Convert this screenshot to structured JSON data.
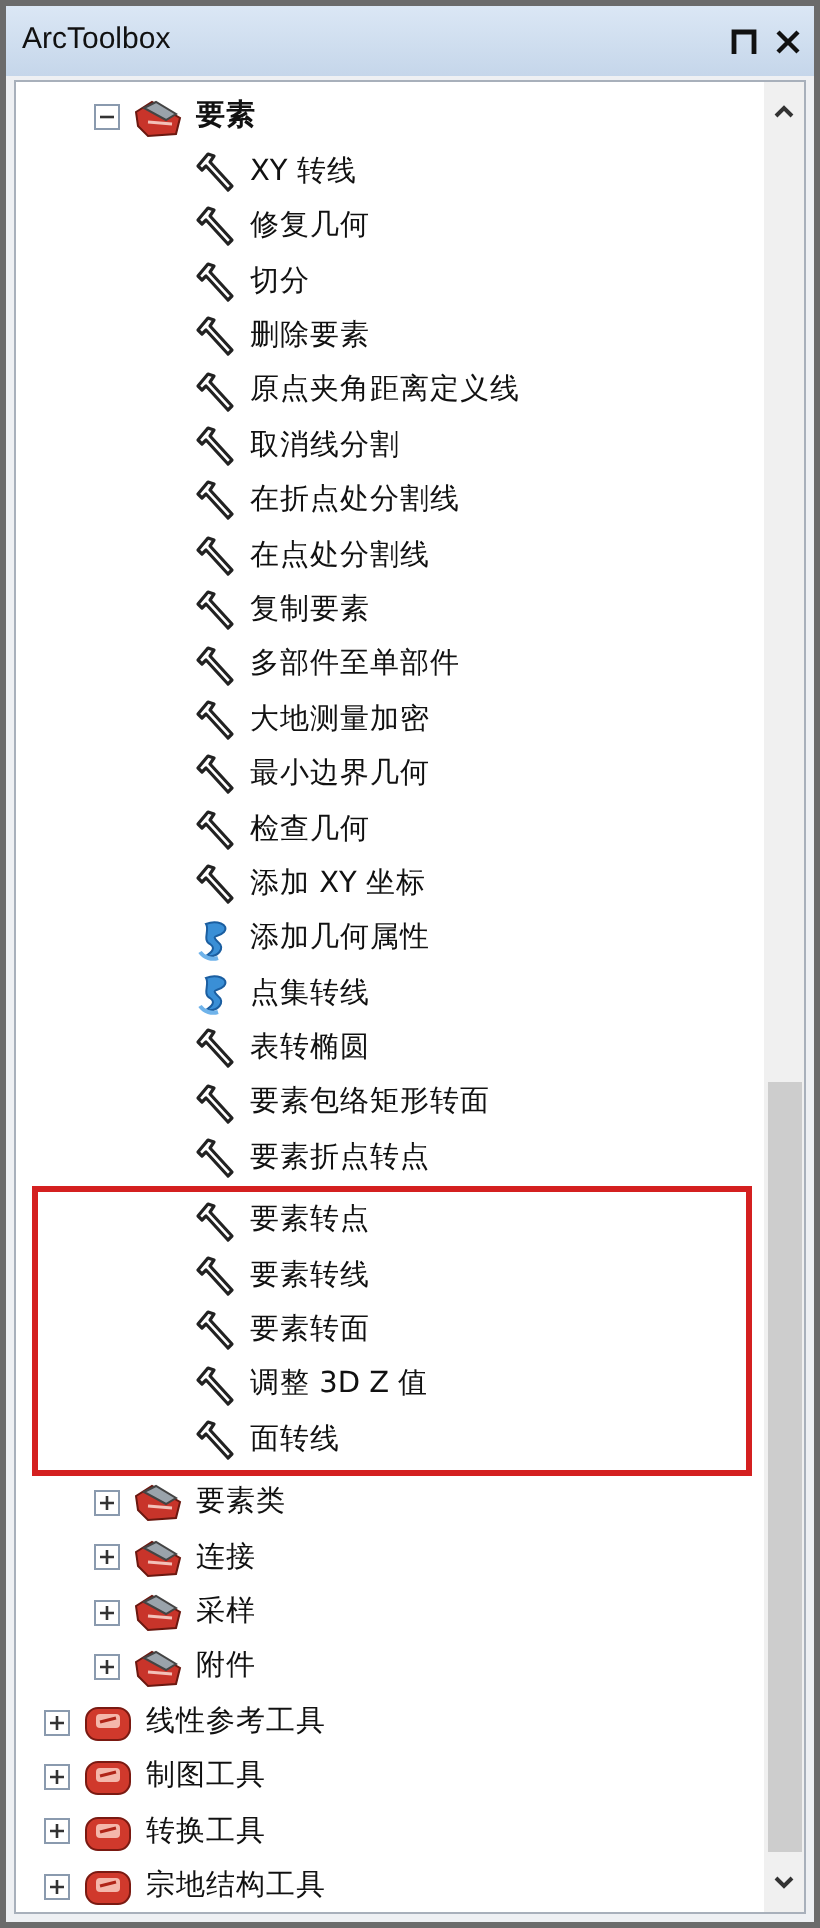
{
  "window": {
    "title": "ArcToolbox"
  },
  "toolsets": [
    {
      "label": "要素",
      "expanded": true,
      "children": [
        {
          "label": "XY 转线",
          "kind": "tool",
          "boxed": false
        },
        {
          "label": "修复几何",
          "kind": "tool",
          "boxed": false
        },
        {
          "label": "切分",
          "kind": "tool",
          "boxed": false
        },
        {
          "label": "删除要素",
          "kind": "tool",
          "boxed": false
        },
        {
          "label": "原点夹角距离定义线",
          "kind": "tool",
          "boxed": false
        },
        {
          "label": "取消线分割",
          "kind": "tool",
          "boxed": false
        },
        {
          "label": "在折点处分割线",
          "kind": "tool",
          "boxed": false
        },
        {
          "label": "在点处分割线",
          "kind": "tool",
          "boxed": false
        },
        {
          "label": "复制要素",
          "kind": "tool",
          "boxed": false
        },
        {
          "label": "多部件至单部件",
          "kind": "tool",
          "boxed": false
        },
        {
          "label": "大地测量加密",
          "kind": "tool",
          "boxed": false
        },
        {
          "label": "最小边界几何",
          "kind": "tool",
          "boxed": false
        },
        {
          "label": "检查几何",
          "kind": "tool",
          "boxed": false
        },
        {
          "label": "添加 XY 坐标",
          "kind": "tool",
          "boxed": false
        },
        {
          "label": "添加几何属性",
          "kind": "script",
          "boxed": false
        },
        {
          "label": "点集转线",
          "kind": "script",
          "boxed": false
        },
        {
          "label": "表转椭圆",
          "kind": "tool",
          "boxed": false
        },
        {
          "label": "要素包络矩形转面",
          "kind": "tool",
          "boxed": false
        },
        {
          "label": "要素折点转点",
          "kind": "tool",
          "boxed": false
        },
        {
          "label": "要素转点",
          "kind": "tool",
          "boxed": true
        },
        {
          "label": "要素转线",
          "kind": "tool",
          "boxed": true
        },
        {
          "label": "要素转面",
          "kind": "tool",
          "boxed": true
        },
        {
          "label": "调整 3D Z 值",
          "kind": "tool",
          "boxed": true
        },
        {
          "label": "面转线",
          "kind": "tool",
          "boxed": true
        }
      ]
    },
    {
      "label": "要素类",
      "expanded": false
    },
    {
      "label": "连接",
      "expanded": false
    },
    {
      "label": "采样",
      "expanded": false
    },
    {
      "label": "附件",
      "expanded": false
    }
  ],
  "toolboxes": [
    {
      "label": "线性参考工具",
      "expanded": false
    },
    {
      "label": "制图工具",
      "expanded": false
    },
    {
      "label": "转换工具",
      "expanded": false
    },
    {
      "label": "宗地结构工具",
      "expanded": false
    }
  ]
}
